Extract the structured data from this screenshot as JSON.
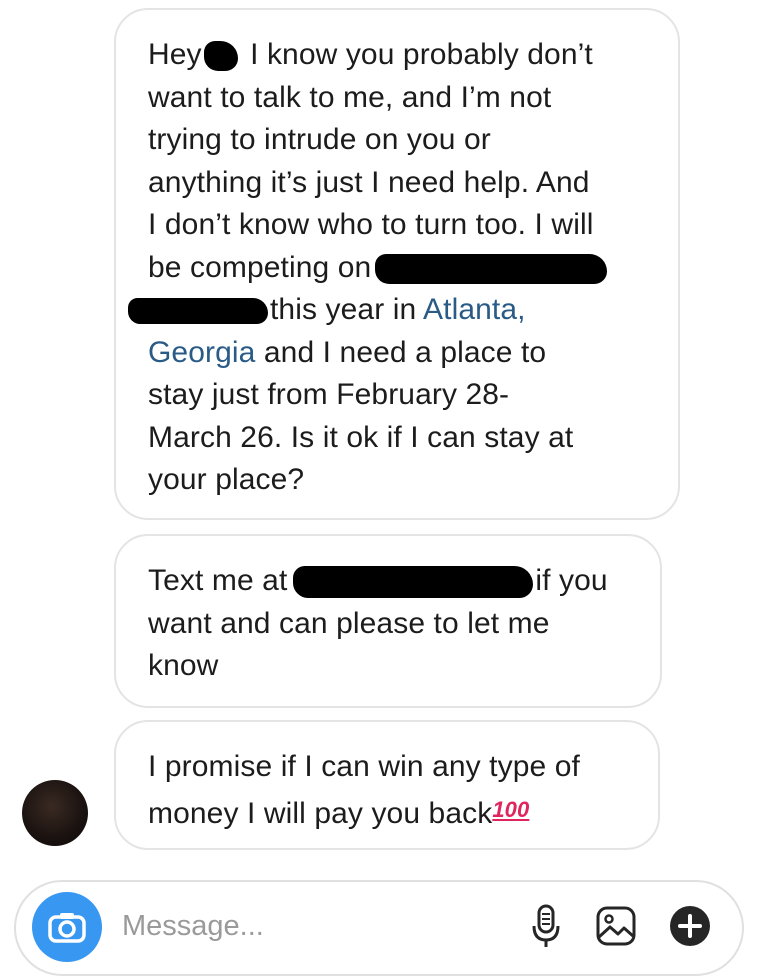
{
  "messages": [
    {
      "lines": [
        {
          "pre": "Hey",
          "redact": "small",
          "post": " I know you probably don’t"
        },
        {
          "text": "want to talk to me, and I’m not"
        },
        {
          "text": "trying to intrude on you or"
        },
        {
          "text": "anything it’s just I need help. And"
        },
        {
          "text": "I don’t know who to turn too. I will"
        },
        {
          "pre": "be competing on",
          "redact": "wide"
        },
        {
          "redactLead": "wide",
          "post": "this year in ",
          "link": "Atlanta,"
        },
        {
          "link": "Georgia",
          "post": " and I need a place to"
        },
        {
          "text": "stay just from February 28-"
        },
        {
          "text": "March 26. Is it ok if I can stay at"
        },
        {
          "text": "your place?"
        }
      ]
    },
    {
      "lines": [
        {
          "pre": "Text me at",
          "redact": "phone",
          "post": "if you"
        },
        {
          "text": "want and can please to let me"
        },
        {
          "text": "know"
        }
      ]
    },
    {
      "lines": [
        {
          "text": "I promise if I can win any type of"
        },
        {
          "pre": "money I will pay you back",
          "emoji": "100"
        }
      ]
    }
  ],
  "composer": {
    "placeholder": "Message...",
    "icons": [
      "camera-icon",
      "microphone-icon",
      "gallery-icon",
      "plus-icon"
    ]
  },
  "colors": {
    "link": "#2a5b86",
    "accent": "#3897f0",
    "bubble_border": "#e4e4e4"
  }
}
